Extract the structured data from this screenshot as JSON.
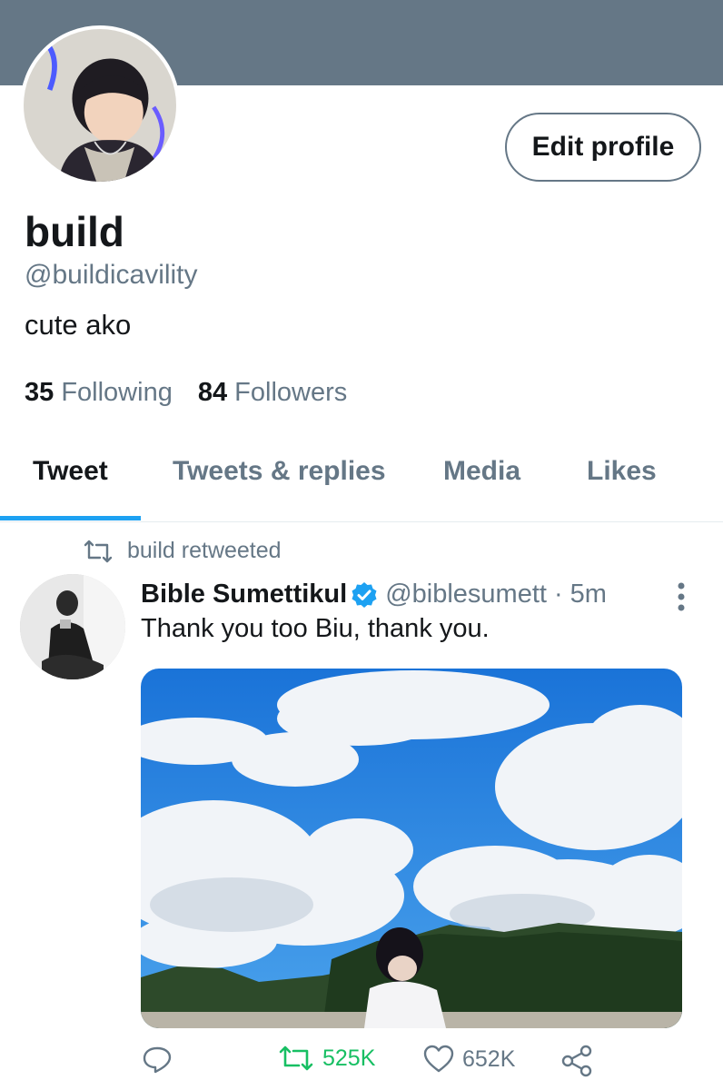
{
  "profile": {
    "display_name": "build",
    "handle": "@buildicavility",
    "bio": "cute ako",
    "edit_button": "Edit profile",
    "following_count": "35",
    "following_label": "Following",
    "followers_count": "84",
    "followers_label": "Followers"
  },
  "tabs": [
    {
      "label": "Tweet",
      "active": true
    },
    {
      "label": "Tweets & replies",
      "active": false
    },
    {
      "label": "Media",
      "active": false
    },
    {
      "label": "Likes",
      "active": false
    }
  ],
  "tweet": {
    "retweet_note": "build retweeted",
    "author_name": "Bible Sumettikul",
    "author_handle": "@biblesumett",
    "time": "· 5m",
    "text": "Thank you too Biu, thank you.",
    "retweets": "525K",
    "likes": "652K"
  },
  "colors": {
    "banner": "#657786",
    "accent": "#1da1f2",
    "retweet_green": "#17bf63",
    "secondary_text": "#657786"
  },
  "icons": [
    "retweet-icon",
    "verified-badge-icon",
    "more-vertical-icon",
    "reply-icon",
    "like-icon",
    "share-icon"
  ]
}
